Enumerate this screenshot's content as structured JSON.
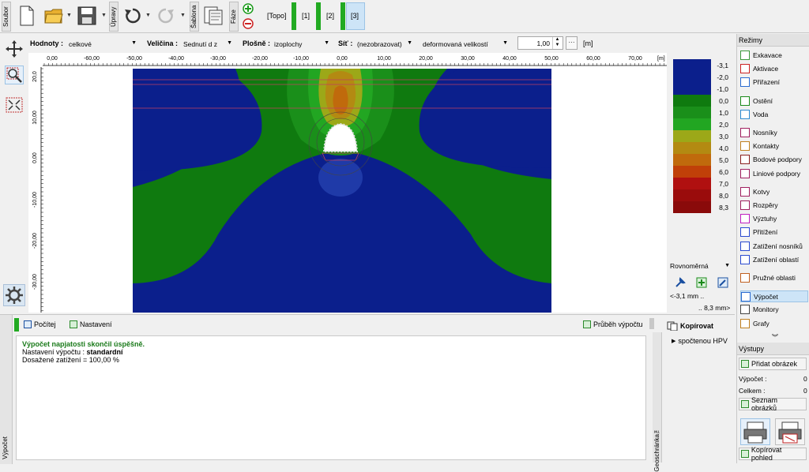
{
  "toolbar": {
    "soubor": "Soubor",
    "upravy": "Úpravy",
    "sablona": "Šablona",
    "faze": "Fáze",
    "topo": "[Topo]",
    "phases": [
      "[1]",
      "[2]",
      "[3]"
    ]
  },
  "filter": {
    "hodnoty_label": "Hodnoty :",
    "hodnoty_value": "celkové",
    "velicina_label": "Veličina :",
    "velicina_value": "Sednutí d z",
    "plosne_label": "Plošně :",
    "plosne_value": "izoplochy",
    "sit_label": "Síť :",
    "sit_value": "(nezobrazovat)",
    "deform_value": "deformovaná velikostí",
    "scale_value": "1,00",
    "unit": "[m]"
  },
  "axis": {
    "x_ticks": [
      "0,00",
      "-60,00",
      "-50,00",
      "-40,00",
      "-30,00",
      "-20,00",
      "-10,00",
      "0,00",
      "10,00",
      "20,00",
      "30,00",
      "40,00",
      "50,00",
      "60,00",
      "70,00"
    ],
    "x_unit": "[m]",
    "y_ticks": [
      "20,0",
      "10,00",
      "0,00",
      "-10,00",
      "-20,00",
      "-30,00"
    ]
  },
  "legend": {
    "values": [
      "-3,1",
      "-2,0",
      "-1,0",
      "0,0",
      "1,0",
      "2,0",
      "3,0",
      "4,0",
      "5,0",
      "6,0",
      "7,0",
      "8,0",
      "8,3"
    ],
    "colors": [
      "#0b1f8c",
      "#0b1f8c",
      "#0b1f8c",
      "#0f7a0f",
      "#1a8f1a",
      "#22a622",
      "#9ca818",
      "#b38a12",
      "#c06a0c",
      "#c04008",
      "#b01010",
      "#9a0c0c",
      "#8a0a0a"
    ],
    "distribution": "Rovnoměrná",
    "range_min": "<-3,1 mm ..",
    "range_max": ".. 8,3 mm>"
  },
  "right_panel": {
    "rezimy": "Režimy",
    "items": [
      "Exkavace",
      "Aktivace",
      "Přiřazení",
      "Ostění",
      "Voda",
      "Nosníky",
      "Kontakty",
      "Bodové podpory",
      "Liniové podpory",
      "Kotvy",
      "Rozpěry",
      "Výztuhy",
      "Přitížení",
      "Zatížení nosníků",
      "Zatížení oblastí",
      "Pružné oblasti",
      "Výpočet",
      "Monitory",
      "Grafy"
    ],
    "vystupy": "Výstupy",
    "pridat_obrazek": "Přidat obrázek",
    "vypocet_label": "Výpočet :",
    "vypocet_count": "0",
    "celkem_label": "Celkem :",
    "celkem_count": "0",
    "seznam_obrazku": "Seznam obrázků",
    "kopirovat_pohled": "Kopírovat pohled"
  },
  "bottom": {
    "pocitej": "Počítej",
    "nastaveni": "Nastavení",
    "prubeh": "Průběh výpočtu",
    "line1": "Výpočet napjatosti skončil úspěšně.",
    "line2_label": "Nastavení výpočtu : ",
    "line2_value": "standardní",
    "line3": "Dosažené zatížení = 100,00 %",
    "side_vypocet": "Výpočet",
    "geoschranka": "Geoschránka™",
    "kopirovat": "Kopírovat",
    "spoctenou": "spočtenou HPV"
  }
}
